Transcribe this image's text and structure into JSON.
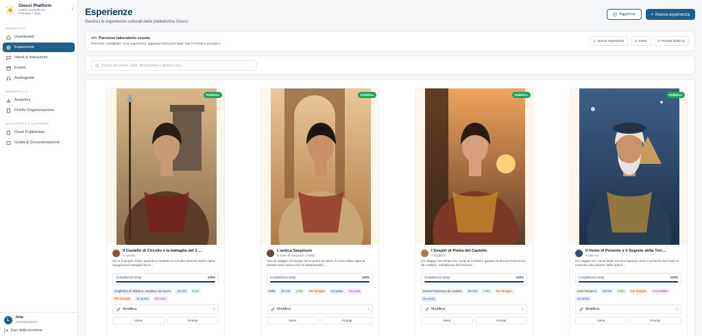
{
  "brand": {
    "title": "Glocci Platform",
    "subtitle1": "Admin Console 3.0",
    "subtitle2": "Premium / 4511"
  },
  "sidebar": {
    "sections": [
      {
        "label": "OPERATIVITÀ",
        "items": [
          {
            "label": "Dashboard",
            "icon": "home-icon"
          },
          {
            "label": "Esperienze",
            "icon": "globe-icon",
            "active": true
          },
          {
            "label": "Intent & Interazioni",
            "icon": "chat-icon"
          },
          {
            "label": "Eventi",
            "icon": "calendar-icon"
          },
          {
            "label": "Audioguide",
            "icon": "headphones-icon"
          }
        ]
      },
      {
        "label": "INSIGHTS & IA",
        "items": [
          {
            "label": "Analytics",
            "icon": "chart-icon"
          },
          {
            "label": "Profilo Organizzazione",
            "icon": "building-icon"
          }
        ]
      },
      {
        "label": "CONFORMITÀ & SUPPORTO",
        "items": [
          {
            "label": "Oneri Pubblicitari",
            "icon": "document-icon"
          },
          {
            "label": "Guida & Documentazione",
            "icon": "book-icon"
          }
        ]
      }
    ],
    "user": {
      "initial": "L",
      "name": "livia",
      "role": "Amministratore"
    },
    "logout": "Esci dalla sessione"
  },
  "header": {
    "title": "Esperienze",
    "subtitle": "Gestisci le esperienze culturali della piattaforma Glocci",
    "refresh": "Aggiorna",
    "new": "Nuova esperienza"
  },
  "lab": {
    "title": "Percorso laboratorio scuola",
    "desc": "Percorso consigliato: crea esperienza, aggiungi intent principali, usa i Prompt e prompt A.",
    "steps": [
      "1. Nuova esperienza",
      "2. Intent",
      "3. Prompt finale IA"
    ]
  },
  "search": {
    "placeholder": "Cerca per nome, città, descrizione o demius loci..."
  },
  "card_common": {
    "status": "Pubblico",
    "completion_label": "Completezza setup",
    "edit_label": "Modifica",
    "foot": [
      "Intent",
      "Prompt"
    ]
  },
  "cards": [
    {
      "title": "Il Castello di Circello e la battaglia del 3 ...",
      "author": "Circello",
      "desc": "Vivi il 3 giugno 1494, quando il Castello di Circello divenne teatro della sanguinosa battaglia tra le...",
      "completion": "100%",
      "completion_value": 100,
      "tags": [
        {
          "t": "Guglielmo di Valtolino, cavaliere del lavoro",
          "c": "gray"
        },
        {
          "t": "45 min",
          "c": "blue"
        },
        {
          "t": "5 ver",
          "c": "green"
        },
        {
          "t": "Per famiglie",
          "c": "orange"
        },
        {
          "t": "Su posto",
          "c": "blue"
        },
        {
          "t": "Da casa",
          "c": "purple"
        }
      ]
    },
    {
      "title": "L'antica Saepinum",
      "author": "Scavi di Saepinum (Altilia)",
      "desc": "Vivi un viaggio nel tempo tra le pietre di Altilia. Io sono Milla, figlia di questa terra antica che ho attraversato...",
      "completion": "100%",
      "completion_value": 100,
      "tags": [
        {
          "t": "Milla",
          "c": "gray"
        },
        {
          "t": "30 min",
          "c": "blue"
        },
        {
          "t": "2 km",
          "c": "green"
        },
        {
          "t": "Per famiglie",
          "c": "orange"
        },
        {
          "t": "Su posto",
          "c": "blue"
        },
        {
          "t": "Da casa",
          "c": "purple"
        }
      ]
    },
    {
      "title": "I Sospiri di Pietra del Castello",
      "author": "Gagliano",
      "desc": "Un viaggio nel tempo tra i vicoli di Castello, guidati da Donna Francesca de Castelo, nobildonna del Seicent...",
      "completion": "100%",
      "completion_value": 100,
      "tags": [
        {
          "t": "Donna Francesca de Castelo",
          "c": "gray"
        },
        {
          "t": "50 min",
          "c": "blue"
        },
        {
          "t": "1 km",
          "c": "green"
        },
        {
          "t": "Per famiglie",
          "c": "orange"
        },
        {
          "t": "Su posto",
          "c": "blue"
        }
      ]
    },
    {
      "title": "Il Vento di Ponente e il Segreto della Torr...",
      "author": "Salvone",
      "desc": "Un viaggio tra i vicoli della vecchia Savona, dove il profumo del mare si mescola alla polvere delle antich...",
      "completion": "100%",
      "completion_value": 100,
      "tags": [
        {
          "t": "Leon Panacca",
          "c": "gray"
        },
        {
          "t": "45 min",
          "c": "blue"
        },
        {
          "t": "1 km",
          "c": "green"
        },
        {
          "t": "Per famiglie",
          "c": "orange"
        },
        {
          "t": "Accessibile",
          "c": "purple"
        },
        {
          "t": "Su posto",
          "c": "blue"
        }
      ]
    }
  ]
}
